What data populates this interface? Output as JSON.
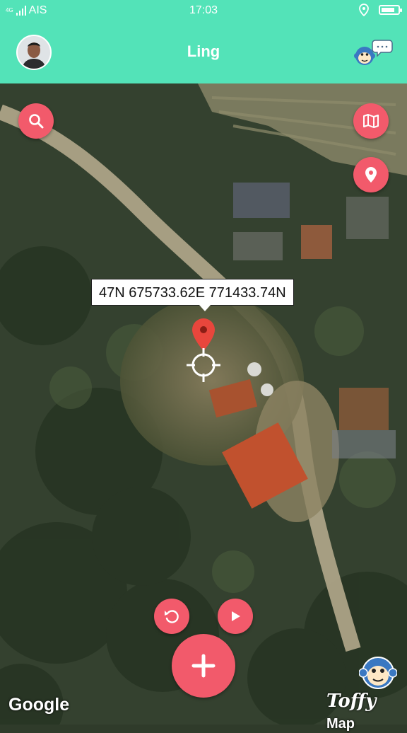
{
  "status_bar": {
    "network": "4G",
    "carrier": "AIS",
    "time": "17:03",
    "battery_level": 0.8
  },
  "app_bar": {
    "title": "Ling",
    "avatar_icon": "user-avatar",
    "right_icon": "monkey-chat-icon"
  },
  "map": {
    "location_label": "47N 675733.62E 771433.74N",
    "attribution": "Google",
    "brand": {
      "name": "Toffy",
      "suffix": "Map"
    }
  },
  "buttons": {
    "search": "search-icon",
    "map_layers": "map-icon",
    "my_location": "location-pin-icon",
    "refresh": "refresh-icon",
    "play": "play-icon",
    "add": "plus-icon"
  },
  "colors": {
    "accent": "#53e3b8",
    "fab": "#f25a6b",
    "marker": "#e8463c"
  }
}
